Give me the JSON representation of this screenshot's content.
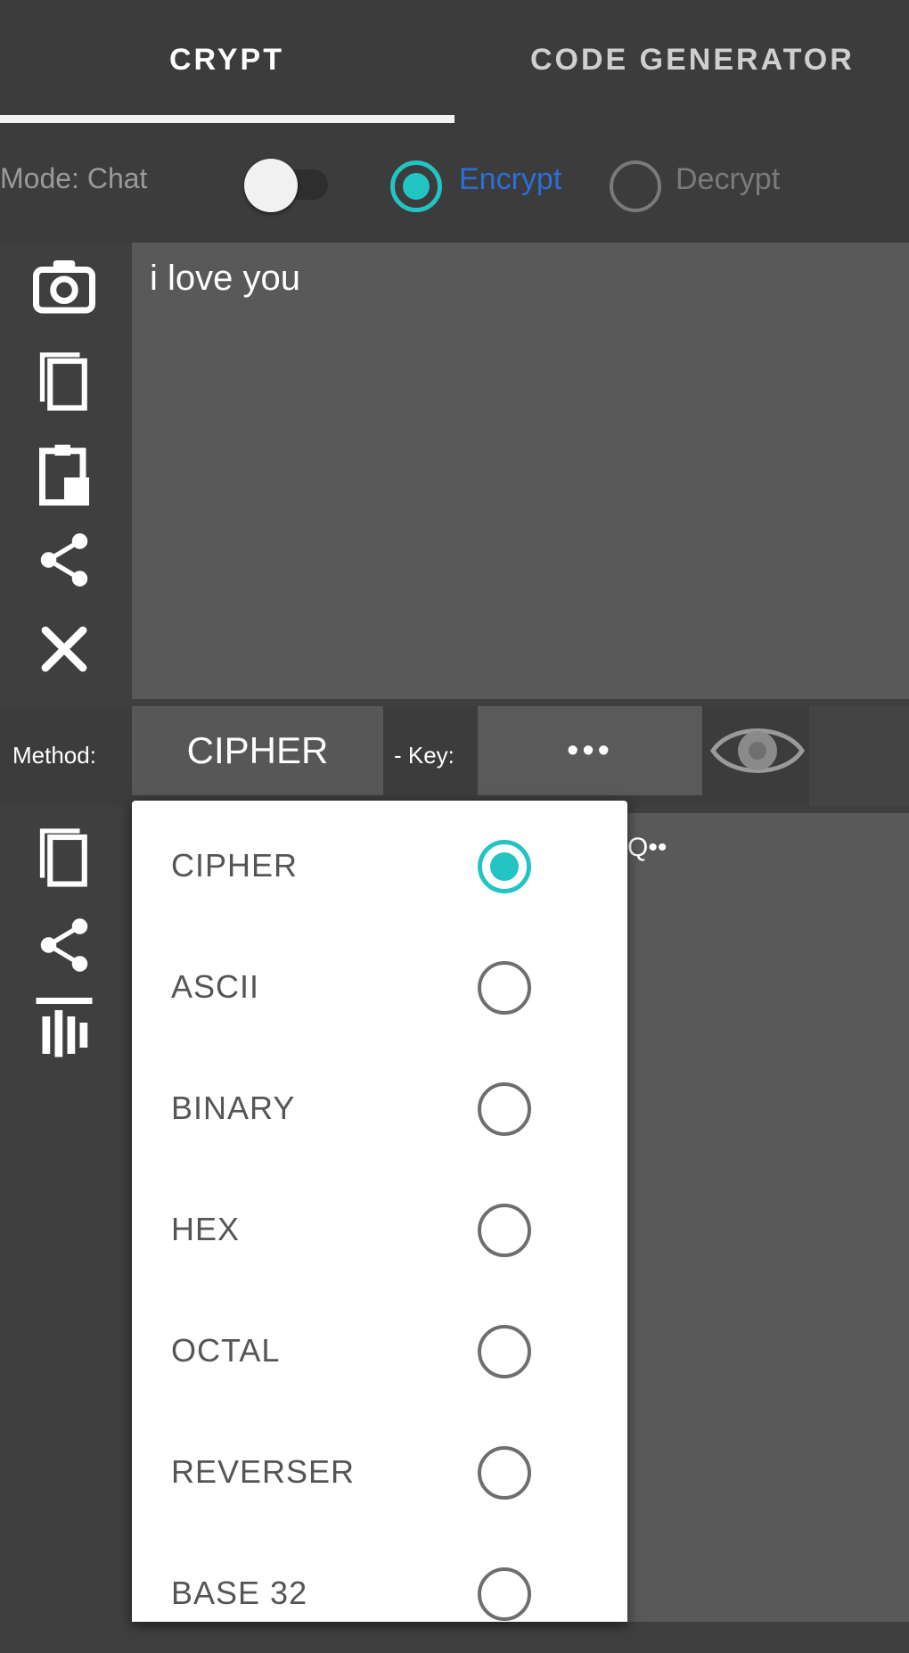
{
  "tabs": [
    {
      "label": "CRYPT",
      "selected": true
    },
    {
      "label": "CODE GENERATOR",
      "selected": false
    }
  ],
  "mode": {
    "label": "Mode: Chat",
    "toggle_on": false,
    "options": [
      {
        "label": "Encrypt",
        "selected": true
      },
      {
        "label": "Decrypt",
        "selected": false
      }
    ]
  },
  "input": {
    "text": "i love you"
  },
  "input_tools": [
    "camera-icon",
    "copy-icon",
    "paste-icon",
    "share-icon",
    "clear-icon"
  ],
  "method": {
    "label": "Method:",
    "value": "CIPHER"
  },
  "key": {
    "label": "- Key:",
    "value": "•••"
  },
  "output_tools": [
    "copy-icon",
    "share-icon",
    "equalizer-icon"
  ],
  "output": {
    "snippet": "Q••"
  },
  "method_menu": [
    {
      "label": "CIPHER",
      "selected": true
    },
    {
      "label": "ASCII",
      "selected": false
    },
    {
      "label": "BINARY",
      "selected": false
    },
    {
      "label": "HEX",
      "selected": false
    },
    {
      "label": "OCTAL",
      "selected": false
    },
    {
      "label": "REVERSER",
      "selected": false
    },
    {
      "label": "BASE 32",
      "selected": false
    }
  ],
  "colors": {
    "accent": "#23c4c4",
    "link": "#2b6fd6",
    "background": "#3f3f3f",
    "panel": "#595959"
  }
}
